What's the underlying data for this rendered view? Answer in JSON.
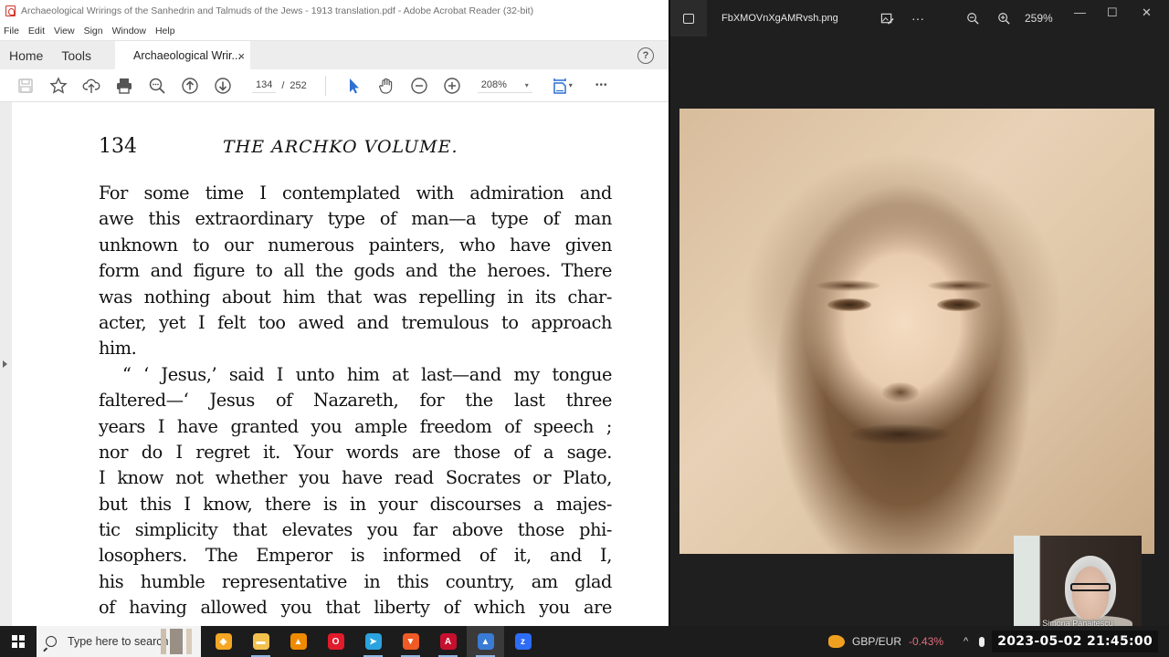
{
  "acrobat": {
    "window_title": "Archaeological Wrirings of the Sanhedrin and Talmuds of the Jews - 1913 translation.pdf - Adobe Acrobat Reader (32-bit)",
    "menu": [
      "File",
      "Edit",
      "View",
      "Sign",
      "Window",
      "Help"
    ],
    "nav_tabs": {
      "home": "Home",
      "tools": "Tools"
    },
    "doc_tab": {
      "label": "Archaeological Wrir...",
      "close": "×"
    },
    "help_icon": "?",
    "toolbar": {
      "current_page": "134",
      "page_sep": "/",
      "total_pages": "252",
      "zoom": "208%",
      "zoom_caret": "▾",
      "more": "•••"
    },
    "page": {
      "number": "134",
      "running_head": "THE ARCHKO VOLUME.",
      "paragraph1": [
        "For some time I contemplated with admiration and",
        "awe this extraordinary type of man—a type of man",
        "unknown to our numerous painters, who have given",
        "form and figure to all the gods and the heroes.  There",
        "was nothing about him that was repelling in its char-",
        "acter, yet I felt too awed and tremulous to approach",
        "him."
      ],
      "paragraph2": [
        "“ ‘ Jesus,’ said I unto him at last—and my tongue",
        "faltered—‘ Jesus of Nazareth, for the last three",
        "years I have granted you ample freedom of speech ;",
        "nor do I regret it.   Your words are those of a sage.",
        "I know not whether you have read Socrates or Plato,",
        "but this I know, there is in your discourses a majes-",
        "tic simplicity that elevates you far above those phi-",
        "losophers.  The Emperor is informed of it, and I,",
        "his humble representative in this country, am glad",
        "of having allowed you that liberty of which you are"
      ]
    }
  },
  "photos": {
    "filename": "FbXMOVnXgAMRvsh.png",
    "more": "···",
    "zoom_level": "259%",
    "window_controls": {
      "minimize": "—",
      "maximize": "☐",
      "close": "✕"
    },
    "webcam_name": "Simona Panaitescu"
  },
  "taskbar": {
    "search_placeholder": "Type here to search",
    "apps": [
      {
        "name": "brave-vpn",
        "color": "#f5a623",
        "glyph": "◈",
        "running": false,
        "active": false
      },
      {
        "name": "file-explorer",
        "color": "#f2c14e",
        "glyph": "▬",
        "running": true,
        "active": false
      },
      {
        "name": "vlc",
        "color": "#f08a00",
        "glyph": "▲",
        "running": false,
        "active": false
      },
      {
        "name": "opera",
        "color": "#e01b2b",
        "glyph": "O",
        "running": false,
        "active": false
      },
      {
        "name": "telegram",
        "color": "#2aa3df",
        "glyph": "➤",
        "running": true,
        "active": false
      },
      {
        "name": "brave",
        "color": "#f05a24",
        "glyph": "▼",
        "running": true,
        "active": false
      },
      {
        "name": "acrobat",
        "color": "#c8102e",
        "glyph": "A",
        "running": true,
        "active": false
      },
      {
        "name": "photos",
        "color": "#3a7bd5",
        "glyph": "▲",
        "running": true,
        "active": true
      },
      {
        "name": "zoom",
        "color": "#2d6cf6",
        "glyph": "z",
        "running": false,
        "active": false
      }
    ],
    "ticker": "GBP/EUR",
    "ticker_change": "-0.43%",
    "tray_chevron": "^",
    "clock": "2023-05-02  21:45:00"
  }
}
